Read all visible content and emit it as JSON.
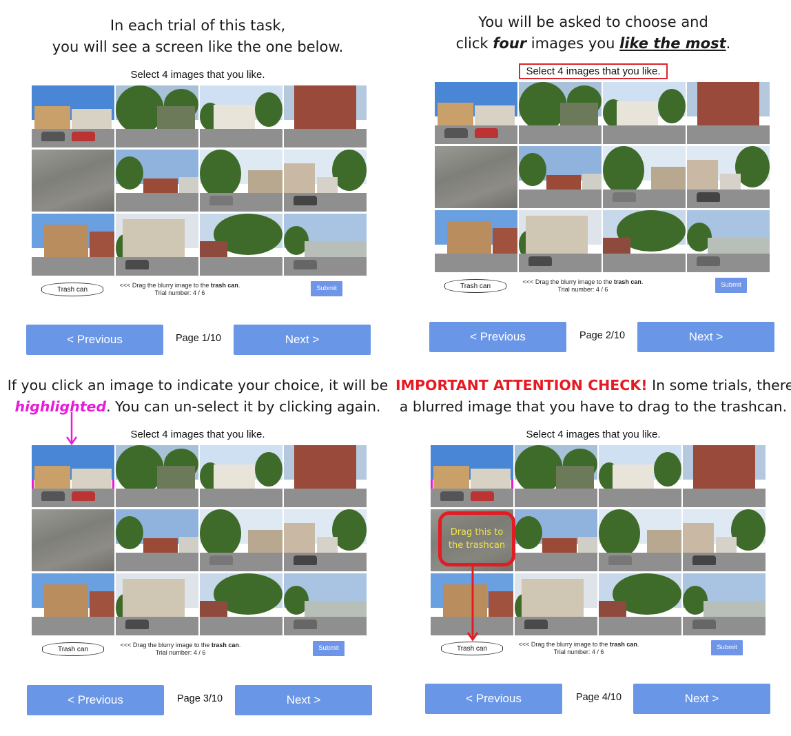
{
  "common": {
    "instruction": "Select 4 images that you like.",
    "trash_label": "Trash can",
    "drag_prefix": "<<< Drag the blurry image to the ",
    "drag_bold": "trash can",
    "drag_suffix": ".",
    "trial_text": "Trial number: 4 / 6",
    "submit_label": "Submit",
    "previous_label": "< Previous",
    "next_label": "Next >"
  },
  "panels": [
    {
      "heading_line1": "In each trial of this task,",
      "heading_line2": "you will see a screen like the one below.",
      "page_label": "Page 1/10"
    },
    {
      "heading_line1": "You will be asked to choose and",
      "heading_line2_pre": "click ",
      "heading_line2_em1": "four",
      "heading_line2_mid": " images you ",
      "heading_line2_em2": "like the most",
      "heading_line2_post": ".",
      "page_label": "Page 2/10"
    },
    {
      "heading_line1": "If you click an image to indicate your choice, it will be",
      "heading_line2_em": "highlighted",
      "heading_line2_post": ". You can un-select  it by clicking again.",
      "page_label": "Page 3/10"
    },
    {
      "heading_line1_em": "IMPORTANT ATTENTION CHECK!",
      "heading_line1_post": " In some trials, there is",
      "heading_line2": "a blurred image that you have to drag to the trashcan.",
      "callout_line1": "Drag this to",
      "callout_line2": "the trashcan",
      "page_label": "Page 4/10"
    }
  ],
  "colors": {
    "button_blue": "#6a96e8",
    "highlight_magenta": "#e81cd7",
    "alert_red": "#e51b24",
    "callout_yellow": "#f0e44a"
  }
}
